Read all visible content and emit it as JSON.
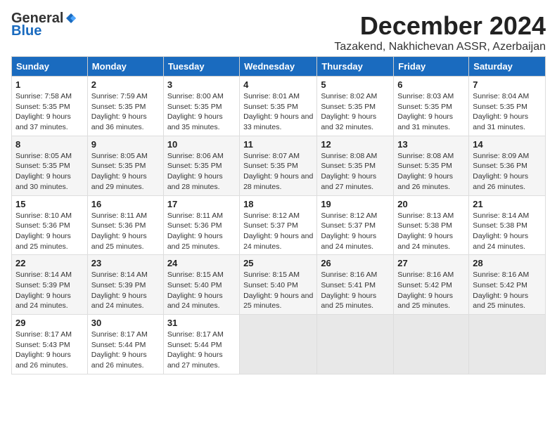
{
  "logo": {
    "general": "General",
    "blue": "Blue"
  },
  "title": "December 2024",
  "subtitle": "Tazakend, Nakhichevan ASSR, Azerbaijan",
  "headers": [
    "Sunday",
    "Monday",
    "Tuesday",
    "Wednesday",
    "Thursday",
    "Friday",
    "Saturday"
  ],
  "weeks": [
    [
      {
        "day": "1",
        "sunrise": "7:58 AM",
        "sunset": "5:35 PM",
        "daylight": "9 hours and 37 minutes."
      },
      {
        "day": "2",
        "sunrise": "7:59 AM",
        "sunset": "5:35 PM",
        "daylight": "9 hours and 36 minutes."
      },
      {
        "day": "3",
        "sunrise": "8:00 AM",
        "sunset": "5:35 PM",
        "daylight": "9 hours and 35 minutes."
      },
      {
        "day": "4",
        "sunrise": "8:01 AM",
        "sunset": "5:35 PM",
        "daylight": "9 hours and 33 minutes."
      },
      {
        "day": "5",
        "sunrise": "8:02 AM",
        "sunset": "5:35 PM",
        "daylight": "9 hours and 32 minutes."
      },
      {
        "day": "6",
        "sunrise": "8:03 AM",
        "sunset": "5:35 PM",
        "daylight": "9 hours and 31 minutes."
      },
      {
        "day": "7",
        "sunrise": "8:04 AM",
        "sunset": "5:35 PM",
        "daylight": "9 hours and 31 minutes."
      }
    ],
    [
      {
        "day": "8",
        "sunrise": "8:05 AM",
        "sunset": "5:35 PM",
        "daylight": "9 hours and 30 minutes."
      },
      {
        "day": "9",
        "sunrise": "8:05 AM",
        "sunset": "5:35 PM",
        "daylight": "9 hours and 29 minutes."
      },
      {
        "day": "10",
        "sunrise": "8:06 AM",
        "sunset": "5:35 PM",
        "daylight": "9 hours and 28 minutes."
      },
      {
        "day": "11",
        "sunrise": "8:07 AM",
        "sunset": "5:35 PM",
        "daylight": "9 hours and 28 minutes."
      },
      {
        "day": "12",
        "sunrise": "8:08 AM",
        "sunset": "5:35 PM",
        "daylight": "9 hours and 27 minutes."
      },
      {
        "day": "13",
        "sunrise": "8:08 AM",
        "sunset": "5:35 PM",
        "daylight": "9 hours and 26 minutes."
      },
      {
        "day": "14",
        "sunrise": "8:09 AM",
        "sunset": "5:36 PM",
        "daylight": "9 hours and 26 minutes."
      }
    ],
    [
      {
        "day": "15",
        "sunrise": "8:10 AM",
        "sunset": "5:36 PM",
        "daylight": "9 hours and 25 minutes."
      },
      {
        "day": "16",
        "sunrise": "8:11 AM",
        "sunset": "5:36 PM",
        "daylight": "9 hours and 25 minutes."
      },
      {
        "day": "17",
        "sunrise": "8:11 AM",
        "sunset": "5:36 PM",
        "daylight": "9 hours and 25 minutes."
      },
      {
        "day": "18",
        "sunrise": "8:12 AM",
        "sunset": "5:37 PM",
        "daylight": "9 hours and 24 minutes."
      },
      {
        "day": "19",
        "sunrise": "8:12 AM",
        "sunset": "5:37 PM",
        "daylight": "9 hours and 24 minutes."
      },
      {
        "day": "20",
        "sunrise": "8:13 AM",
        "sunset": "5:38 PM",
        "daylight": "9 hours and 24 minutes."
      },
      {
        "day": "21",
        "sunrise": "8:14 AM",
        "sunset": "5:38 PM",
        "daylight": "9 hours and 24 minutes."
      }
    ],
    [
      {
        "day": "22",
        "sunrise": "8:14 AM",
        "sunset": "5:39 PM",
        "daylight": "9 hours and 24 minutes."
      },
      {
        "day": "23",
        "sunrise": "8:14 AM",
        "sunset": "5:39 PM",
        "daylight": "9 hours and 24 minutes."
      },
      {
        "day": "24",
        "sunrise": "8:15 AM",
        "sunset": "5:40 PM",
        "daylight": "9 hours and 24 minutes."
      },
      {
        "day": "25",
        "sunrise": "8:15 AM",
        "sunset": "5:40 PM",
        "daylight": "9 hours and 25 minutes."
      },
      {
        "day": "26",
        "sunrise": "8:16 AM",
        "sunset": "5:41 PM",
        "daylight": "9 hours and 25 minutes."
      },
      {
        "day": "27",
        "sunrise": "8:16 AM",
        "sunset": "5:42 PM",
        "daylight": "9 hours and 25 minutes."
      },
      {
        "day": "28",
        "sunrise": "8:16 AM",
        "sunset": "5:42 PM",
        "daylight": "9 hours and 25 minutes."
      }
    ],
    [
      {
        "day": "29",
        "sunrise": "8:17 AM",
        "sunset": "5:43 PM",
        "daylight": "9 hours and 26 minutes."
      },
      {
        "day": "30",
        "sunrise": "8:17 AM",
        "sunset": "5:44 PM",
        "daylight": "9 hours and 26 minutes."
      },
      {
        "day": "31",
        "sunrise": "8:17 AM",
        "sunset": "5:44 PM",
        "daylight": "9 hours and 27 minutes."
      },
      null,
      null,
      null,
      null
    ]
  ]
}
